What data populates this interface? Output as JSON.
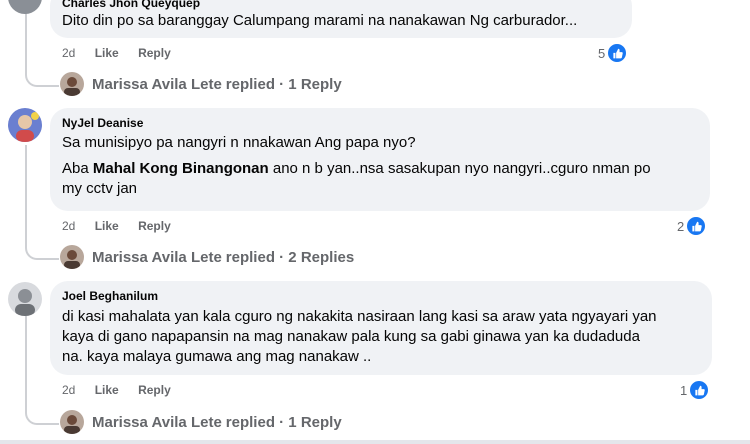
{
  "comments": [
    {
      "author": "Charles Jhon Queyquep",
      "lines": [
        "Dito din po sa baranggay Calumpang marami na nanakawan Ng carburador..."
      ],
      "time": "2d",
      "like": "Like",
      "reply": "Reply",
      "reaction_count": "5",
      "replies_author": "Marissa Avila Lete",
      "replies_text": "replied · 1 Reply"
    },
    {
      "author": "NyJel Deanise",
      "line1": "Sa munisipyo pa nangyri n nnakawan Ang papa nyo?",
      "line2_prefix": "Aba ",
      "line2_mention": "Mahal Kong Binangonan",
      "line2_suffix": " ano n b yan..nsa sasakupan nyo nangyri..cguro nman po",
      "line3": "my cctv jan",
      "time": "2d",
      "like": "Like",
      "reply": "Reply",
      "reaction_count": "2",
      "replies_author": "Marissa Avila Lete",
      "replies_text": "replied · 2 Replies"
    },
    {
      "author": "Joel Beghanilum",
      "lines": [
        "di kasi mahalata yan kala cguro ng nakakita nasiraan lang kasi sa araw yata ngyayari yan",
        "kaya di gano napapansin na mag nanakaw pala kung sa gabi ginawa yan ka dudaduda",
        "na. kaya malaya gumawa ang mag nanakaw .."
      ],
      "time": "2d",
      "like": "Like",
      "reply": "Reply",
      "reaction_count": "1",
      "replies_author": "Marissa Avila Lete",
      "replies_text": "replied · 1 Reply"
    }
  ],
  "colors": {
    "bubble": "#f0f2f5",
    "like_blue": "#1877f2",
    "meta_gray": "#65676b"
  },
  "icons": {
    "reaction": "like-thumb-icon"
  }
}
